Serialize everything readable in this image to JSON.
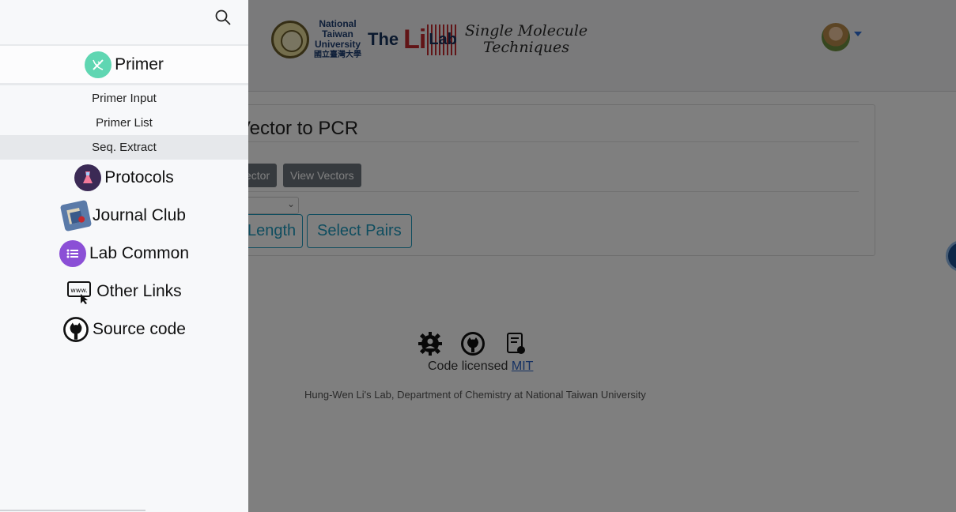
{
  "header": {
    "ntu_lines": [
      "National",
      "Taiwan",
      "University"
    ],
    "ntu_chinese": "國立臺灣大學",
    "lab_the": "The",
    "lab_li": "Li",
    "lab_lab": "Lab",
    "tagline_1": "Single Molecule",
    "tagline_2": "Techniques"
  },
  "card": {
    "title": "Vector to PCR",
    "buttons": [
      "ector",
      "View Vectors"
    ],
    "outline_buttons": [
      "Length",
      "Select Pairs"
    ]
  },
  "footer": {
    "icons": [
      "gear-icon",
      "github-icon",
      "document-bug-icon"
    ],
    "license_text": "Code licensed",
    "license_link": "MIT",
    "credits": "Hung-Wen Li's Lab, Department of Chemistry at National Taiwan University"
  },
  "sidebar": {
    "search_icon": "search-icon",
    "primer": {
      "label": "Primer",
      "icon": "dna-icon",
      "icon_color": "#5fd6b2",
      "items": [
        {
          "label": "Primer Input",
          "active": false
        },
        {
          "label": "Primer List",
          "active": false
        },
        {
          "label": "Seq. Extract",
          "active": true
        }
      ]
    },
    "sections": [
      {
        "label": "Protocols",
        "icon": "flask-icon",
        "icon_color": "#3b2a55"
      },
      {
        "label": "Journal Club",
        "icon": "journal-icon",
        "icon_color": "#5a7aa8"
      },
      {
        "label": "Lab Common",
        "icon": "list-icon",
        "icon_color": "#8b4fd6"
      },
      {
        "label": "Other Links",
        "icon": "www-link-icon",
        "icon_color": "#111111"
      },
      {
        "label": "Source code",
        "icon": "github-icon",
        "icon_color": "#111111"
      }
    ]
  }
}
